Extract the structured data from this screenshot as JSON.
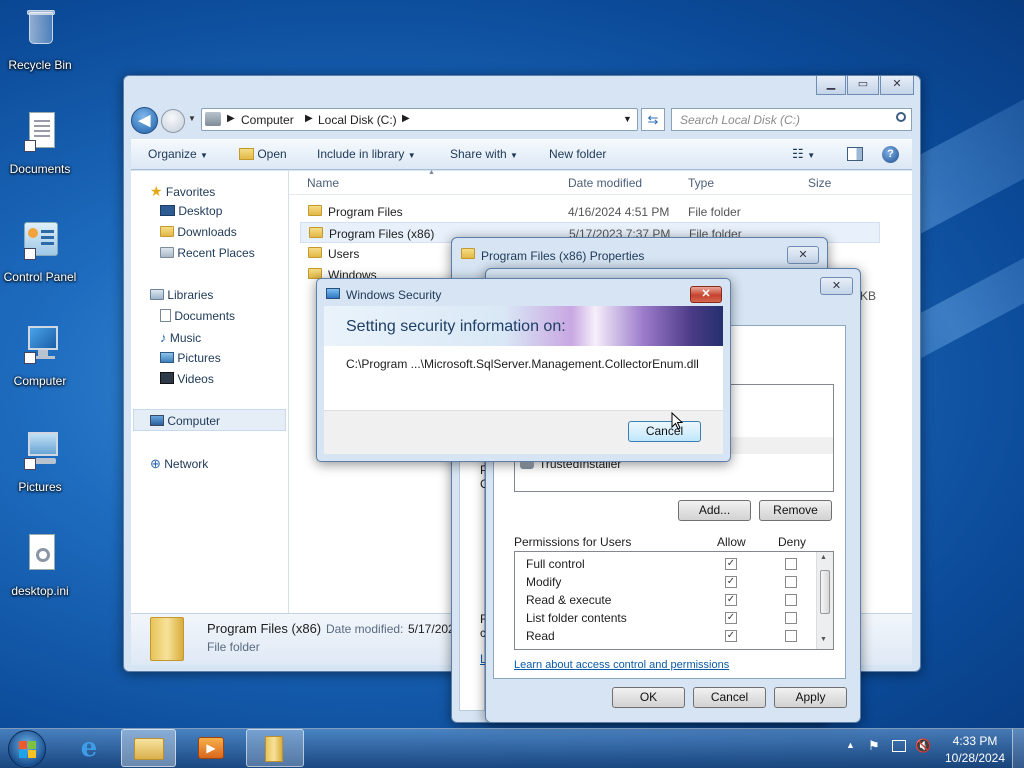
{
  "desktop": {
    "icons": [
      {
        "label": "Recycle Bin"
      },
      {
        "label": "Documents"
      },
      {
        "label": "Control Panel"
      },
      {
        "label": "Computer"
      },
      {
        "label": "Pictures"
      },
      {
        "label": "desktop.ini"
      }
    ]
  },
  "explorer": {
    "breadcrumb": [
      "Computer",
      "Local Disk (C:)"
    ],
    "search_placeholder": "Search Local Disk (C:)",
    "toolbar": {
      "organize": "Organize",
      "open": "Open",
      "include": "Include in library",
      "share": "Share with",
      "new_folder": "New folder"
    },
    "nav": {
      "favorites": "Favorites",
      "desktop": "Desktop",
      "downloads": "Downloads",
      "recent": "Recent Places",
      "libraries": "Libraries",
      "documents": "Documents",
      "music": "Music",
      "pictures": "Pictures",
      "videos": "Videos",
      "computer": "Computer",
      "network": "Network"
    },
    "columns": {
      "name": "Name",
      "date": "Date modified",
      "type": "Type",
      "size": "Size"
    },
    "files": [
      {
        "name": "Program Files",
        "date": "4/16/2024 4:51 PM",
        "type": "File folder"
      },
      {
        "name": "Program Files (x86)",
        "date": "5/17/2023 7:37 PM",
        "type": "File folder"
      },
      {
        "name": "Users",
        "date": "",
        "type": ""
      },
      {
        "name": "Windows",
        "date": "",
        "type": ""
      }
    ],
    "size_fragment": "KB",
    "details": {
      "name": "Program Files (x86)",
      "date_label": "Date modified:",
      "date_value": "5/17/202",
      "type": "File folder"
    }
  },
  "properties": {
    "title": "Program Files (x86) Properties",
    "trusted_installer": "TrustedInstaller",
    "add_button": "Add...",
    "remove_button": "Remove",
    "permissions_for": "Permissions for Users",
    "allow": "Allow",
    "deny": "Deny",
    "permissions": [
      {
        "name": "Full control",
        "allow": true,
        "deny": false
      },
      {
        "name": "Modify",
        "allow": true,
        "deny": false
      },
      {
        "name": "Read & execute",
        "allow": true,
        "deny": false
      },
      {
        "name": "List folder contents",
        "allow": true,
        "deny": false
      },
      {
        "name": "Read",
        "allow": true,
        "deny": false
      }
    ],
    "link": "Learn about access control and permissions",
    "ok": "OK",
    "cancel": "Cancel",
    "apply": "Apply",
    "left_fragments": [
      "P",
      "C",
      "F",
      "c",
      "L"
    ]
  },
  "security_dialog": {
    "title": "Windows Security",
    "heading": "Setting security information on:",
    "path": "C:\\Program ...\\Microsoft.SqlServer.Management.CollectorEnum.dll",
    "cancel": "Cancel"
  },
  "taskbar": {
    "time": "4:33 PM",
    "date": "10/28/2024"
  },
  "colors": {
    "accent": "#1e6cbf",
    "window_frame": "#d6e4f3",
    "selection": "#e5f0fb",
    "link": "#0b5aa8"
  }
}
